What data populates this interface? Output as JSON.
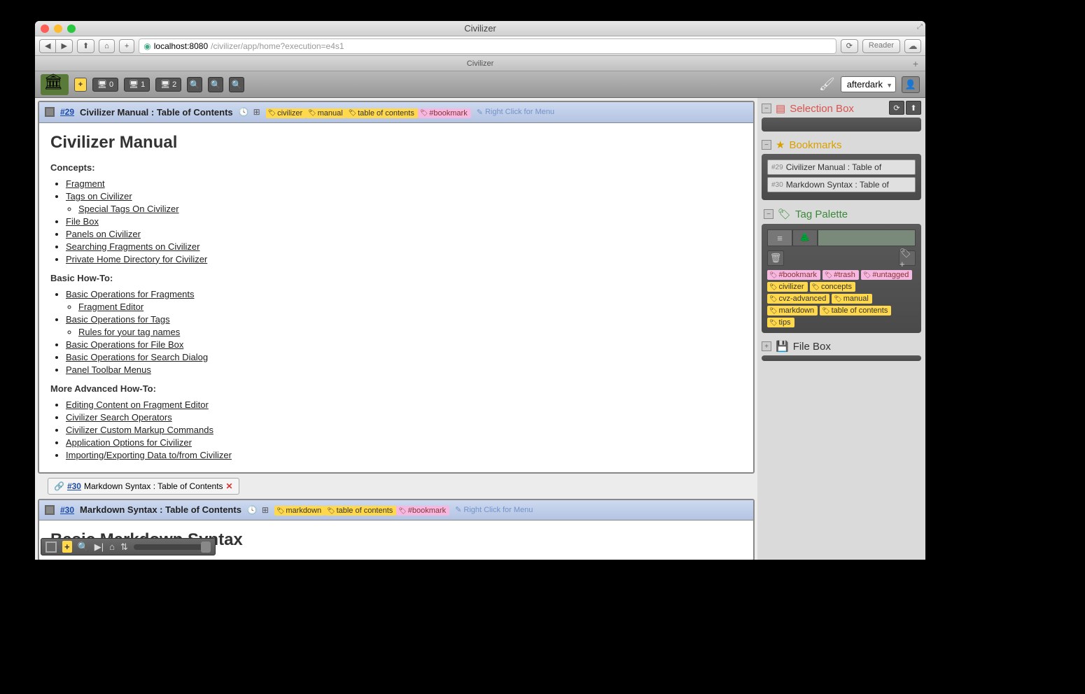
{
  "window": {
    "title": "Civilizer"
  },
  "nav": {
    "url_host": "localhost:8080",
    "url_path": "/civilizer/app/home?execution=e4s1",
    "reader": "Reader",
    "tab": "Civilizer"
  },
  "toolbar": {
    "panels": [
      {
        "icon": "desktop",
        "num": "0"
      },
      {
        "icon": "desktop",
        "num": "1"
      },
      {
        "icon": "desktop",
        "num": "2"
      }
    ],
    "theme": "afterdark"
  },
  "fragments": [
    {
      "id": "#29",
      "title": "Civilizer Manual : Table of Contents",
      "tags": [
        {
          "text": "civilizer",
          "style": "yellow"
        },
        {
          "text": "manual",
          "style": "yellow"
        },
        {
          "text": "table of contents",
          "style": "yellow"
        },
        {
          "text": "#bookmark",
          "style": "pink"
        }
      ],
      "context_hint": "Right Click for Menu",
      "h1": "Civilizer Manual",
      "sections": [
        {
          "heading": "Concepts:",
          "items": [
            {
              "text": "Fragment"
            },
            {
              "text": "Tags on Civilizer",
              "sub": [
                {
                  "text": "Special Tags On Civilizer"
                }
              ]
            },
            {
              "text": "File Box"
            },
            {
              "text": "Panels on Civilizer"
            },
            {
              "text": "Searching Fragments on Civilizer"
            },
            {
              "text": "Private Home Directory for Civilizer"
            }
          ]
        },
        {
          "heading": "Basic How-To:",
          "items": [
            {
              "text": "Basic Operations for Fragments",
              "sub": [
                {
                  "text": "Fragment Editor"
                }
              ]
            },
            {
              "text": "Basic Operations for Tags",
              "sub": [
                {
                  "text": "Rules for your tag names"
                }
              ]
            },
            {
              "text": "Basic Operations for File Box"
            },
            {
              "text": "Basic Operations for Search Dialog"
            },
            {
              "text": "Panel Toolbar Menus"
            }
          ]
        },
        {
          "heading": "More Advanced How-To:",
          "items": [
            {
              "text": "Editing Content on Fragment Editor"
            },
            {
              "text": "Civilizer Search Operators"
            },
            {
              "text": "Civilizer Custom Markup Commands"
            },
            {
              "text": "Application Options for Civilizer"
            },
            {
              "text": "Importing/Exporting Data to/from Civilizer"
            }
          ]
        }
      ],
      "related": {
        "id": "#30",
        "title": "Markdown Syntax : Table of Contents"
      }
    },
    {
      "id": "#30",
      "title": "Markdown Syntax : Table of Contents",
      "tags": [
        {
          "text": "markdown",
          "style": "yellow"
        },
        {
          "text": "table of contents",
          "style": "yellow"
        },
        {
          "text": "#bookmark",
          "style": "pink"
        }
      ],
      "context_hint": "Right Click for Menu",
      "h1": "Basic Markdown Syntax"
    }
  ],
  "sidebar": {
    "selection_box": {
      "title": "Selection Box"
    },
    "bookmarks": {
      "title": "Bookmarks",
      "items": [
        {
          "id": "#29",
          "title": "Civilizer Manual : Table of"
        },
        {
          "id": "#30",
          "title": "Markdown Syntax : Table of"
        }
      ]
    },
    "tag_palette": {
      "title": "Tag Palette",
      "tags": [
        {
          "text": "#bookmark",
          "style": "pink"
        },
        {
          "text": "#trash",
          "style": "pink"
        },
        {
          "text": "#untagged",
          "style": "pink"
        },
        {
          "text": "civilizer",
          "style": "yellow"
        },
        {
          "text": "concepts",
          "style": "yellow"
        },
        {
          "text": "cvz-advanced",
          "style": "yellow"
        },
        {
          "text": "manual",
          "style": "yellow"
        },
        {
          "text": "markdown",
          "style": "yellow"
        },
        {
          "text": "table of contents",
          "style": "yellow"
        },
        {
          "text": "tips",
          "style": "yellow"
        }
      ]
    },
    "file_box": {
      "title": "File Box"
    }
  }
}
